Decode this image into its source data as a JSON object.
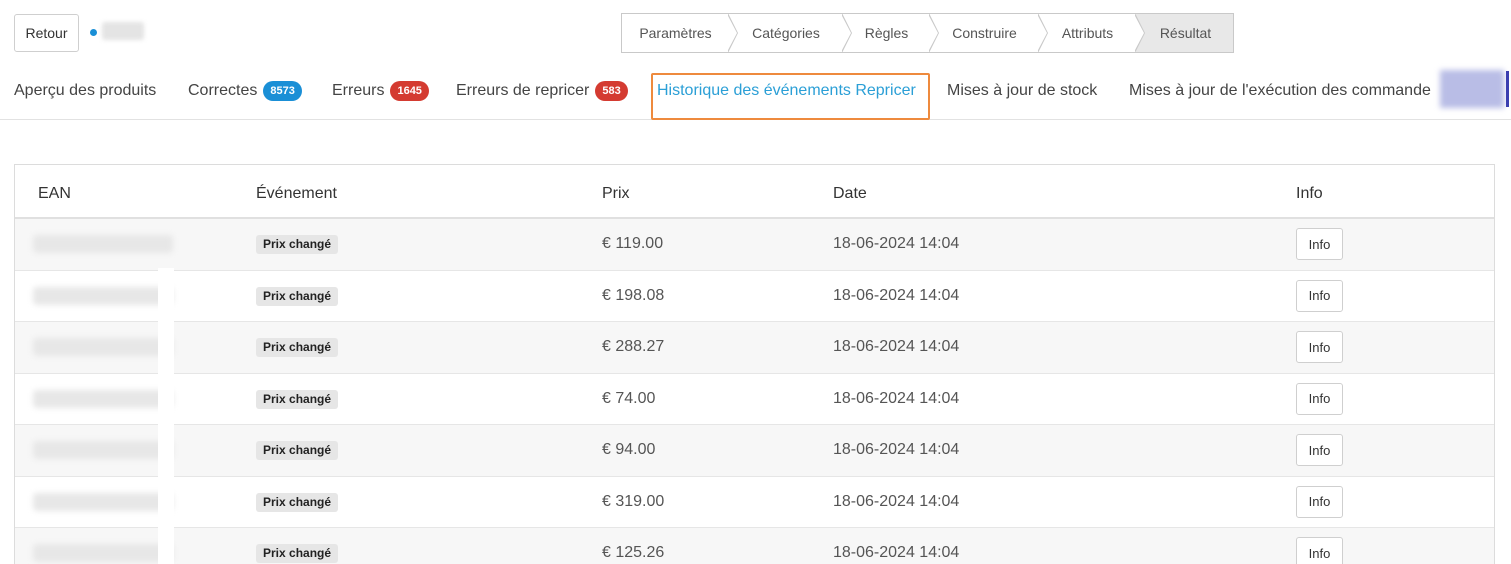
{
  "header": {
    "back_label": "Retour"
  },
  "stepper": {
    "steps": [
      {
        "label": "Paramètres"
      },
      {
        "label": "Catégories"
      },
      {
        "label": "Règles"
      },
      {
        "label": "Construire"
      },
      {
        "label": "Attributs"
      },
      {
        "label": "Résultat"
      }
    ],
    "active_step": "Résultat"
  },
  "tabs": [
    {
      "label": "Aperçu des produits"
    },
    {
      "label": "Correctes",
      "badge": "8573",
      "badge_color": "#1a8fd6"
    },
    {
      "label": "Erreurs",
      "badge": "1645",
      "badge_color": "#d43b31"
    },
    {
      "label": "Erreurs de repricer",
      "badge": "583",
      "badge_color": "#d43b31"
    },
    {
      "label": "Historique des événements Repricer"
    },
    {
      "label": "Mises à jour de stock"
    },
    {
      "label": "Mises à jour de l'exécution des commande"
    }
  ],
  "active_tab": "Historique des événements Repricer",
  "table": {
    "columns": [
      "EAN",
      "Événement",
      "Prix",
      "Date",
      "Info"
    ],
    "rows": [
      {
        "event": "Prix changé",
        "price": "€ 119.00",
        "date": "18-06-2024 14:04",
        "info": "Info"
      },
      {
        "event": "Prix changé",
        "price": "€ 198.08",
        "date": "18-06-2024 14:04",
        "info": "Info"
      },
      {
        "event": "Prix changé",
        "price": "€ 288.27",
        "date": "18-06-2024 14:04",
        "info": "Info"
      },
      {
        "event": "Prix changé",
        "price": "€ 74.00",
        "date": "18-06-2024 14:04",
        "info": "Info"
      },
      {
        "event": "Prix changé",
        "price": "€ 94.00",
        "date": "18-06-2024 14:04",
        "info": "Info"
      },
      {
        "event": "Prix changé",
        "price": "€ 319.00",
        "date": "18-06-2024 14:04",
        "info": "Info"
      },
      {
        "event": "Prix changé",
        "price": "€ 125.26",
        "date": "18-06-2024 14:04",
        "info": "Info"
      }
    ]
  },
  "colors": {
    "accent": "#2b9fd6",
    "highlight": "#ee8a3d",
    "badge_blue": "#1a8fd6",
    "badge_red": "#d43b31"
  }
}
